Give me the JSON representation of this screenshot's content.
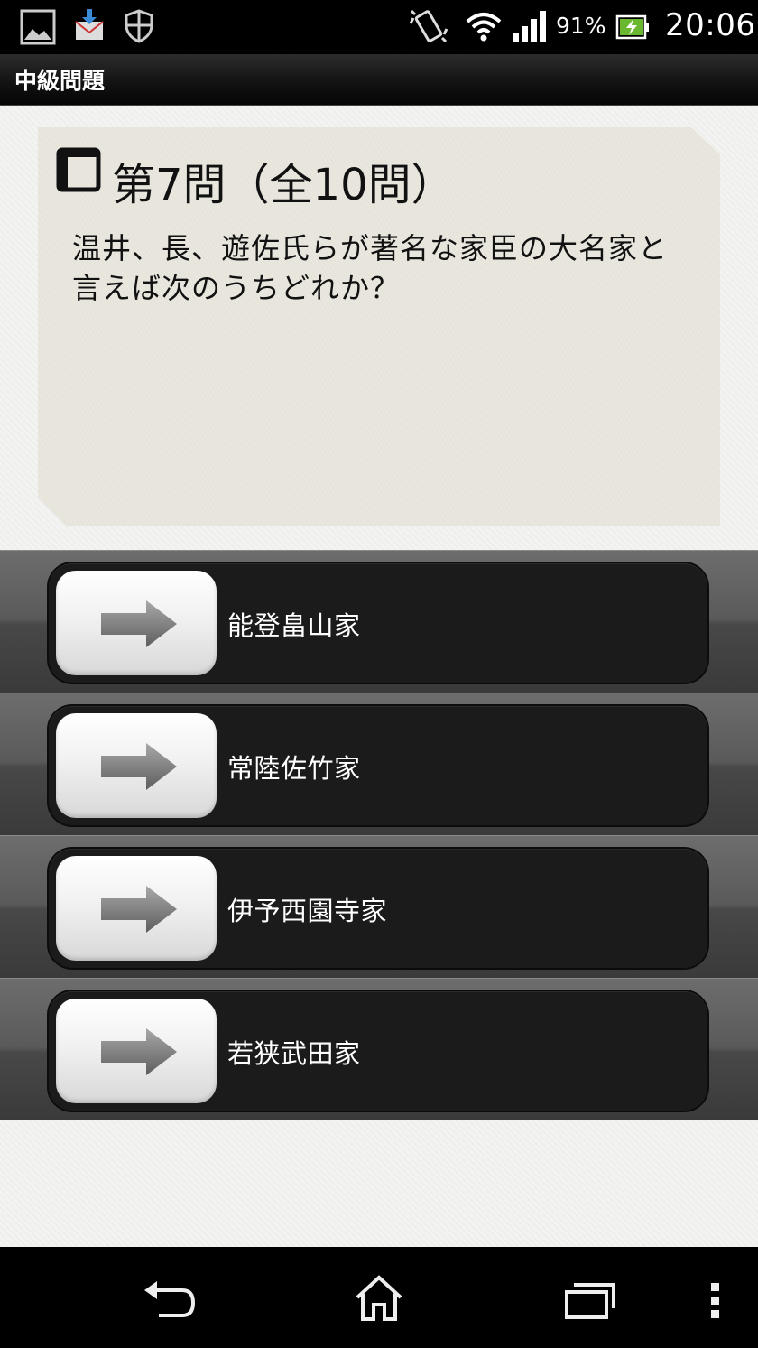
{
  "status_bar": {
    "battery_percent": "91%",
    "time": "20:06",
    "icons": [
      "gallery-icon",
      "mail-download-icon",
      "shield-icon",
      "vibrate-icon",
      "wifi-icon",
      "signal-icon",
      "battery-charging-icon"
    ]
  },
  "action_bar": {
    "title": "中級問題"
  },
  "question": {
    "number_label": "第7問（全10問）",
    "text": "温井、長、遊佐氏らが著名な家臣の大名家と言えば次のうちどれか？"
  },
  "answers": [
    {
      "label": "能登畠山家",
      "icon": "arrow-right-icon"
    },
    {
      "label": "常陸佐竹家",
      "icon": "arrow-right-icon"
    },
    {
      "label": "伊予西園寺家",
      "icon": "arrow-right-icon"
    },
    {
      "label": "若狭武田家",
      "icon": "arrow-right-icon"
    }
  ],
  "nav_bar": {
    "icons": [
      "back-icon",
      "home-icon",
      "recent-apps-icon",
      "overflow-menu-icon"
    ]
  }
}
